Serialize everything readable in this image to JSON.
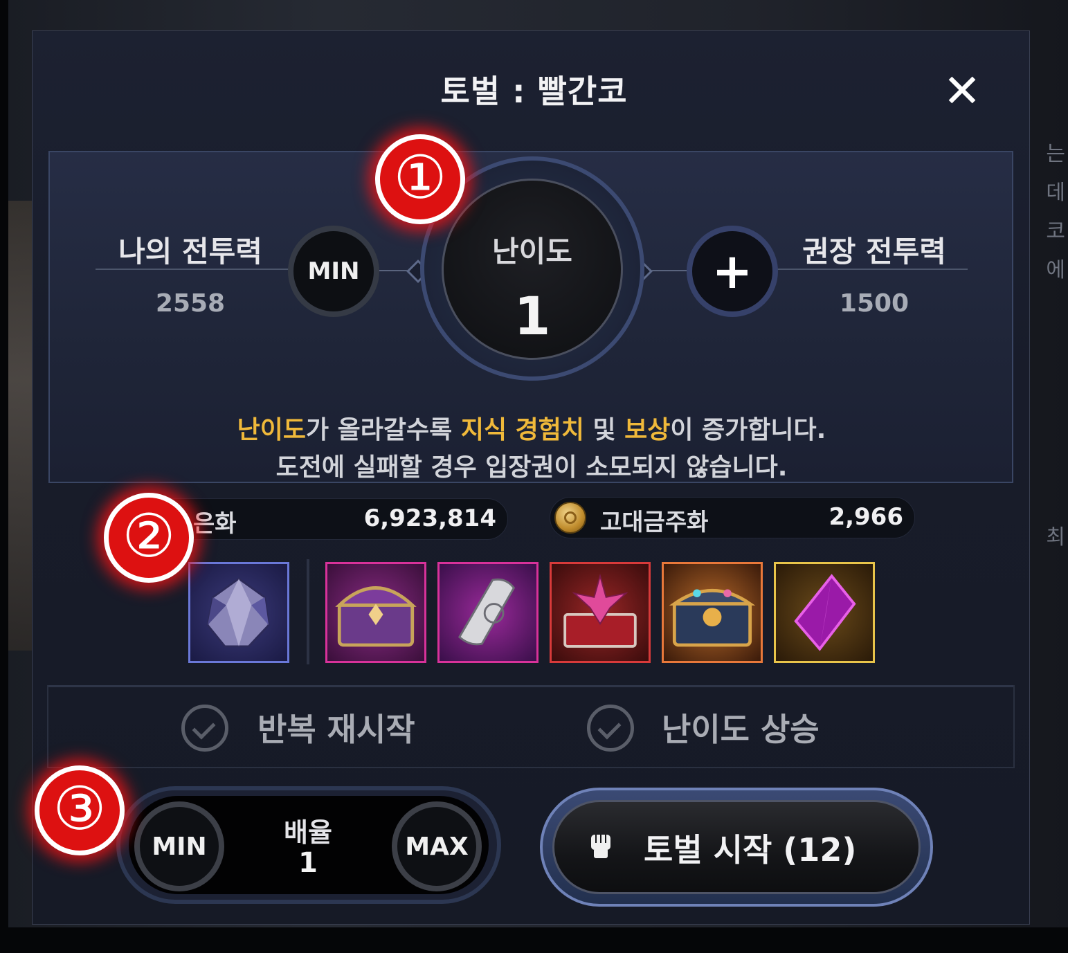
{
  "dialog": {
    "title": "토벌 : 빨간코",
    "close_symbol": "✕"
  },
  "stats": {
    "my_power_label": "나의 전투력",
    "my_power_value": "2558",
    "recommended_power_label": "권장 전투력",
    "recommended_power_value": "1500",
    "min_button": "MIN",
    "plus_button": "+"
  },
  "difficulty": {
    "label": "난이도",
    "value": "1"
  },
  "info": {
    "line1_parts": [
      "난이도",
      "가 올라갈수록 ",
      "지식 경험치",
      " 및 ",
      "보상",
      "이 증가합니다."
    ],
    "line2": "도전에 실패할 경우 입장권이 소모되지 않습니다."
  },
  "currencies": [
    {
      "name": "은화",
      "value": "6,923,814",
      "icon": "silver-coin-icon"
    },
    {
      "name": "고대금주화",
      "value": "2,966",
      "icon": "ancient-gold-coin-icon"
    }
  ],
  "rewards": [
    {
      "icon": "purple-gem-icon",
      "frame_color": "#6a78d8"
    },
    {
      "icon": "purple-treasure-chest-icon",
      "frame_color": "#d8329a"
    },
    {
      "icon": "scroll-icon",
      "frame_color": "#d8329a"
    },
    {
      "icon": "red-gift-chest-icon",
      "frame_color": "#d83a3a"
    },
    {
      "icon": "golden-chest-icon",
      "frame_color": "#e8783a"
    },
    {
      "icon": "magenta-crystal-icon",
      "frame_color": "#e8c44a"
    }
  ],
  "options": {
    "repeat_restart": "반복 재시작",
    "difficulty_up": "난이도 상승"
  },
  "multiplier": {
    "label": "배율",
    "value": "1",
    "min_button": "MIN",
    "max_button": "MAX"
  },
  "start_button": {
    "label": "토벌 시작 (12)"
  },
  "annotations": [
    "①",
    "②",
    "③"
  ],
  "colors": {
    "highlight": "#f0b93a",
    "annotation_red": "#dd1111"
  },
  "background_side_text": [
    "는데",
    "코에",
    "최"
  ]
}
